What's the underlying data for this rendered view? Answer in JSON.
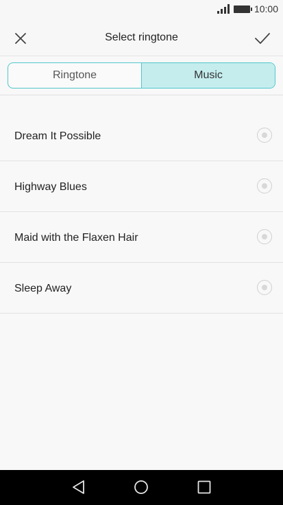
{
  "status_bar": {
    "time": "10:00",
    "icons": [
      "signal-icon",
      "battery-icon"
    ]
  },
  "header": {
    "title": "Select ringtone",
    "close_icon": "close-icon",
    "confirm_icon": "check-icon"
  },
  "tabs": [
    {
      "label": "Ringtone",
      "active": false
    },
    {
      "label": "Music",
      "active": true
    }
  ],
  "songs": [
    {
      "title": "Dream It Possible",
      "selected": false
    },
    {
      "title": "Highway Blues",
      "selected": false
    },
    {
      "title": "Maid with the Flaxen Hair",
      "selected": false
    },
    {
      "title": "Sleep Away",
      "selected": false
    }
  ],
  "nav_bar": {
    "icons": [
      "back-icon",
      "home-icon",
      "recents-icon"
    ]
  },
  "colors": {
    "accent": "#4fc6cc",
    "active_tab_bg": "#c5edee",
    "background": "#f8f8f8",
    "nav_bar": "#000000"
  }
}
